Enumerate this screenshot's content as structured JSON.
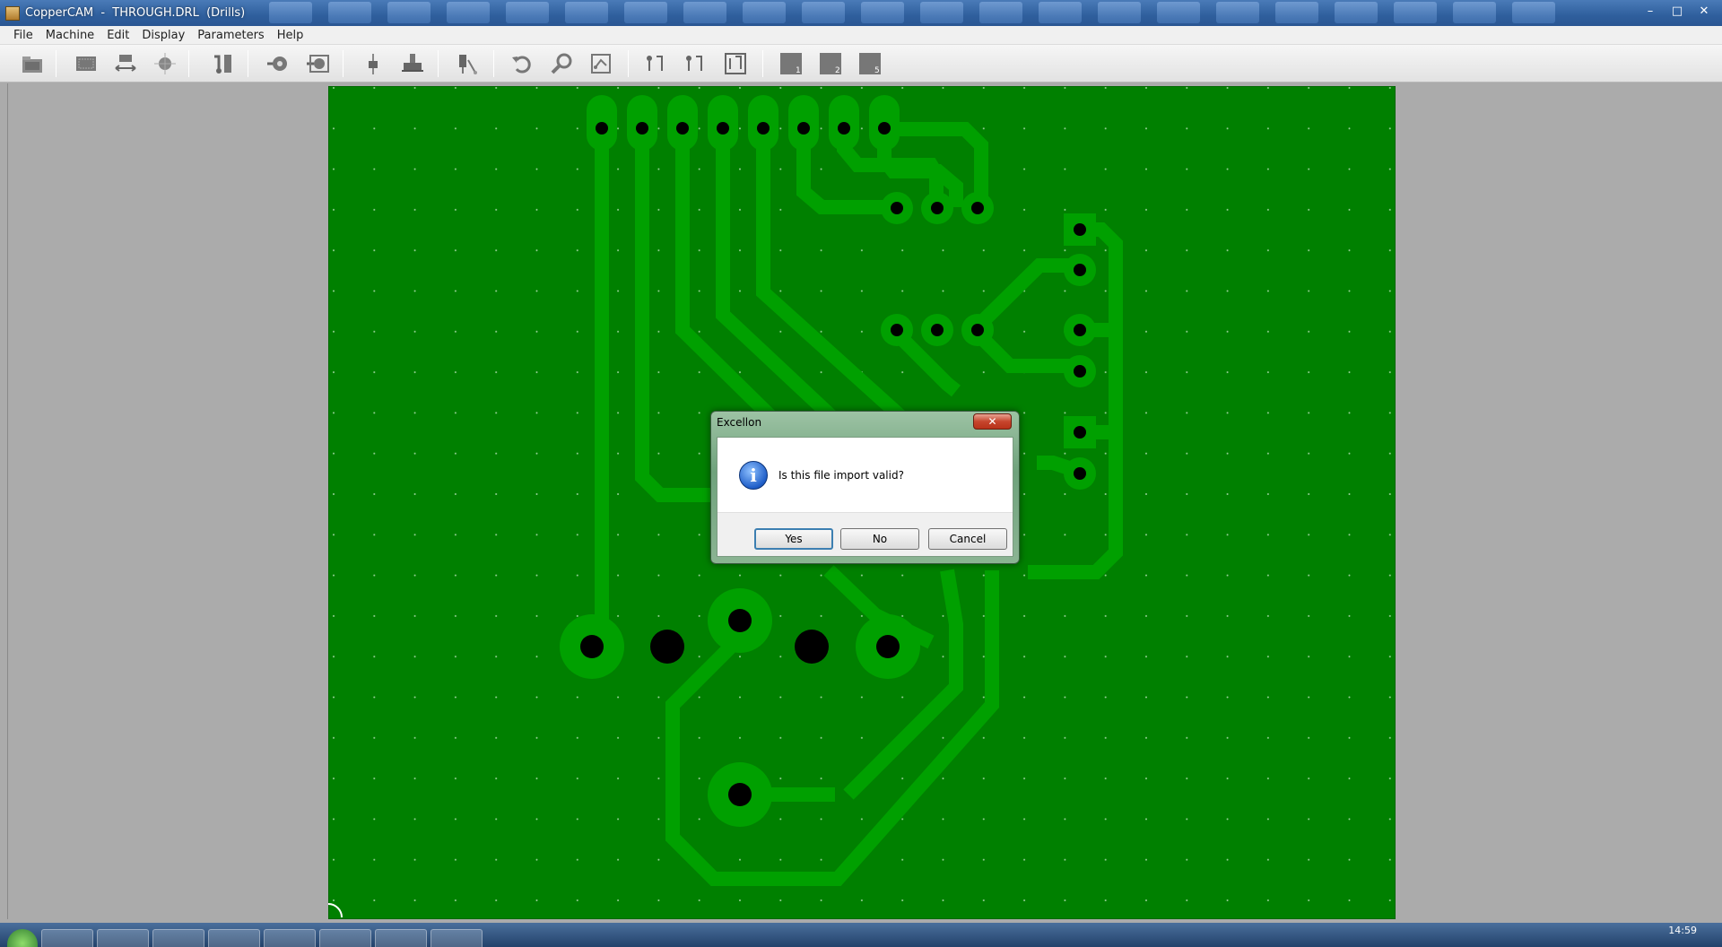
{
  "window": {
    "title": "CopperCAM  -  THROUGH.DRL  (Drills)",
    "minimize": "–",
    "maximize": "□",
    "close": "✕"
  },
  "menu": [
    "File",
    "Machine",
    "Edit",
    "Display",
    "Parameters",
    "Help"
  ],
  "toolbar": {
    "badges": [
      "1",
      "2",
      "5"
    ]
  },
  "dialog": {
    "title": "Excellon",
    "close": "✕",
    "icon": "info-icon",
    "icon_glyph": "i",
    "message": "Is this file import valid?",
    "buttons": {
      "yes": "Yes",
      "no": "No",
      "cancel": "Cancel"
    }
  },
  "taskbar": {
    "clock": "14:59"
  },
  "colors": {
    "board": "#008000",
    "copper": "#00a000",
    "drill": "#000000",
    "grid_dot": "#9ad29a"
  }
}
